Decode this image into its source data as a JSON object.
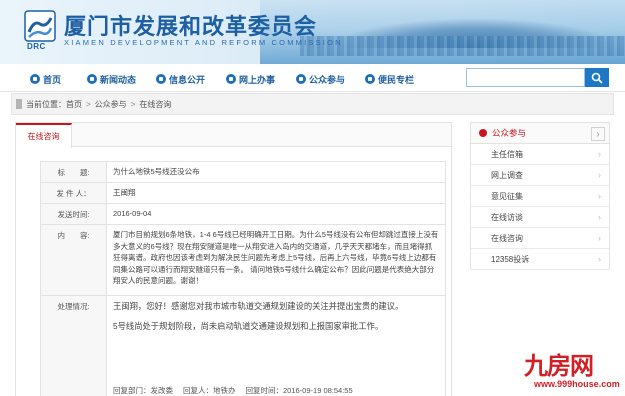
{
  "header": {
    "site_title": "厦门市发展和改革委员会",
    "site_subtitle": "XIAMEN DEVELOPMENT AND REFORM COMMISSION",
    "logo_abbr": "DRC"
  },
  "nav": {
    "items": [
      {
        "label": "首页",
        "icon": "home-icon"
      },
      {
        "label": "新闻动态",
        "icon": "news-icon"
      },
      {
        "label": "信息公开",
        "icon": "document-icon"
      },
      {
        "label": "网上办事",
        "icon": "computer-icon"
      },
      {
        "label": "公众参与",
        "icon": "people-icon"
      },
      {
        "label": "便民专栏",
        "icon": "bookmark-icon"
      }
    ],
    "search": {
      "placeholder": "",
      "button_icon": "search-icon"
    }
  },
  "breadcrumb": {
    "prefix": "当前位置：",
    "items": [
      "首页",
      "公众参与",
      "在线咨询"
    ],
    "separator": ">"
  },
  "main": {
    "tab_label": "在线咨询",
    "fields": {
      "title_label": "标　　题:",
      "title_value": "为什么地铁5号线还没公布",
      "sender_label": "发 件 人：",
      "sender_value": "王闽翔",
      "date_label": "发送时间:",
      "date_value": "2016-09-04",
      "content_label": "内　　容:",
      "content_value": "厦门市目前规划6条地铁，1-4 6号线已经明确开工日期。为什么5号线没有公布但却跳过直接上没有多大意义的6号线？现在翔安隧道是唯一从翔安进入岛内的交通道，几乎天天都堵车，而且堵得抓狂得离谱。政府也因该考虑到为解决民生问题先考虑上5号线，后再上六号线，毕竟6号线上边都有同集公路可以通行而翔安隧道只有一条。 请问地铁5号线什么确定公布？因此问题是代表绝大部分翔安人的民意问题。谢谢！",
      "reply_label": "处理情况:",
      "reply_line1": "王闽翔，您好！感谢您对我市城市轨道交通规划建设的关注并提出宝贵的建议。",
      "reply_line2": "5号线尚处于规划阶段，尚未启动轨道交通建设规划和上报国家审批工作。",
      "reply_dept_label": "回复部门：",
      "reply_dept_value": "发改委",
      "reply_person_label": "回复人：",
      "reply_person_value": "地铁办",
      "reply_time_label": "回复时间：",
      "reply_time_value": "2016-09-19 08:54:55"
    }
  },
  "sidebar": {
    "title": "公众参与",
    "more_icon": "chevron-right-icon",
    "items": [
      {
        "label": "主任信箱"
      },
      {
        "label": "网上调查"
      },
      {
        "label": "意见征集"
      },
      {
        "label": "在线访谈"
      },
      {
        "label": "在线咨询"
      },
      {
        "label": "12358投诉"
      }
    ]
  },
  "watermark": {
    "brand": "九房网",
    "url": "www.999house.com"
  },
  "colors": {
    "accent_blue": "#1f6fb8",
    "accent_red": "#c8161d",
    "watermark_red": "#d11f25"
  }
}
